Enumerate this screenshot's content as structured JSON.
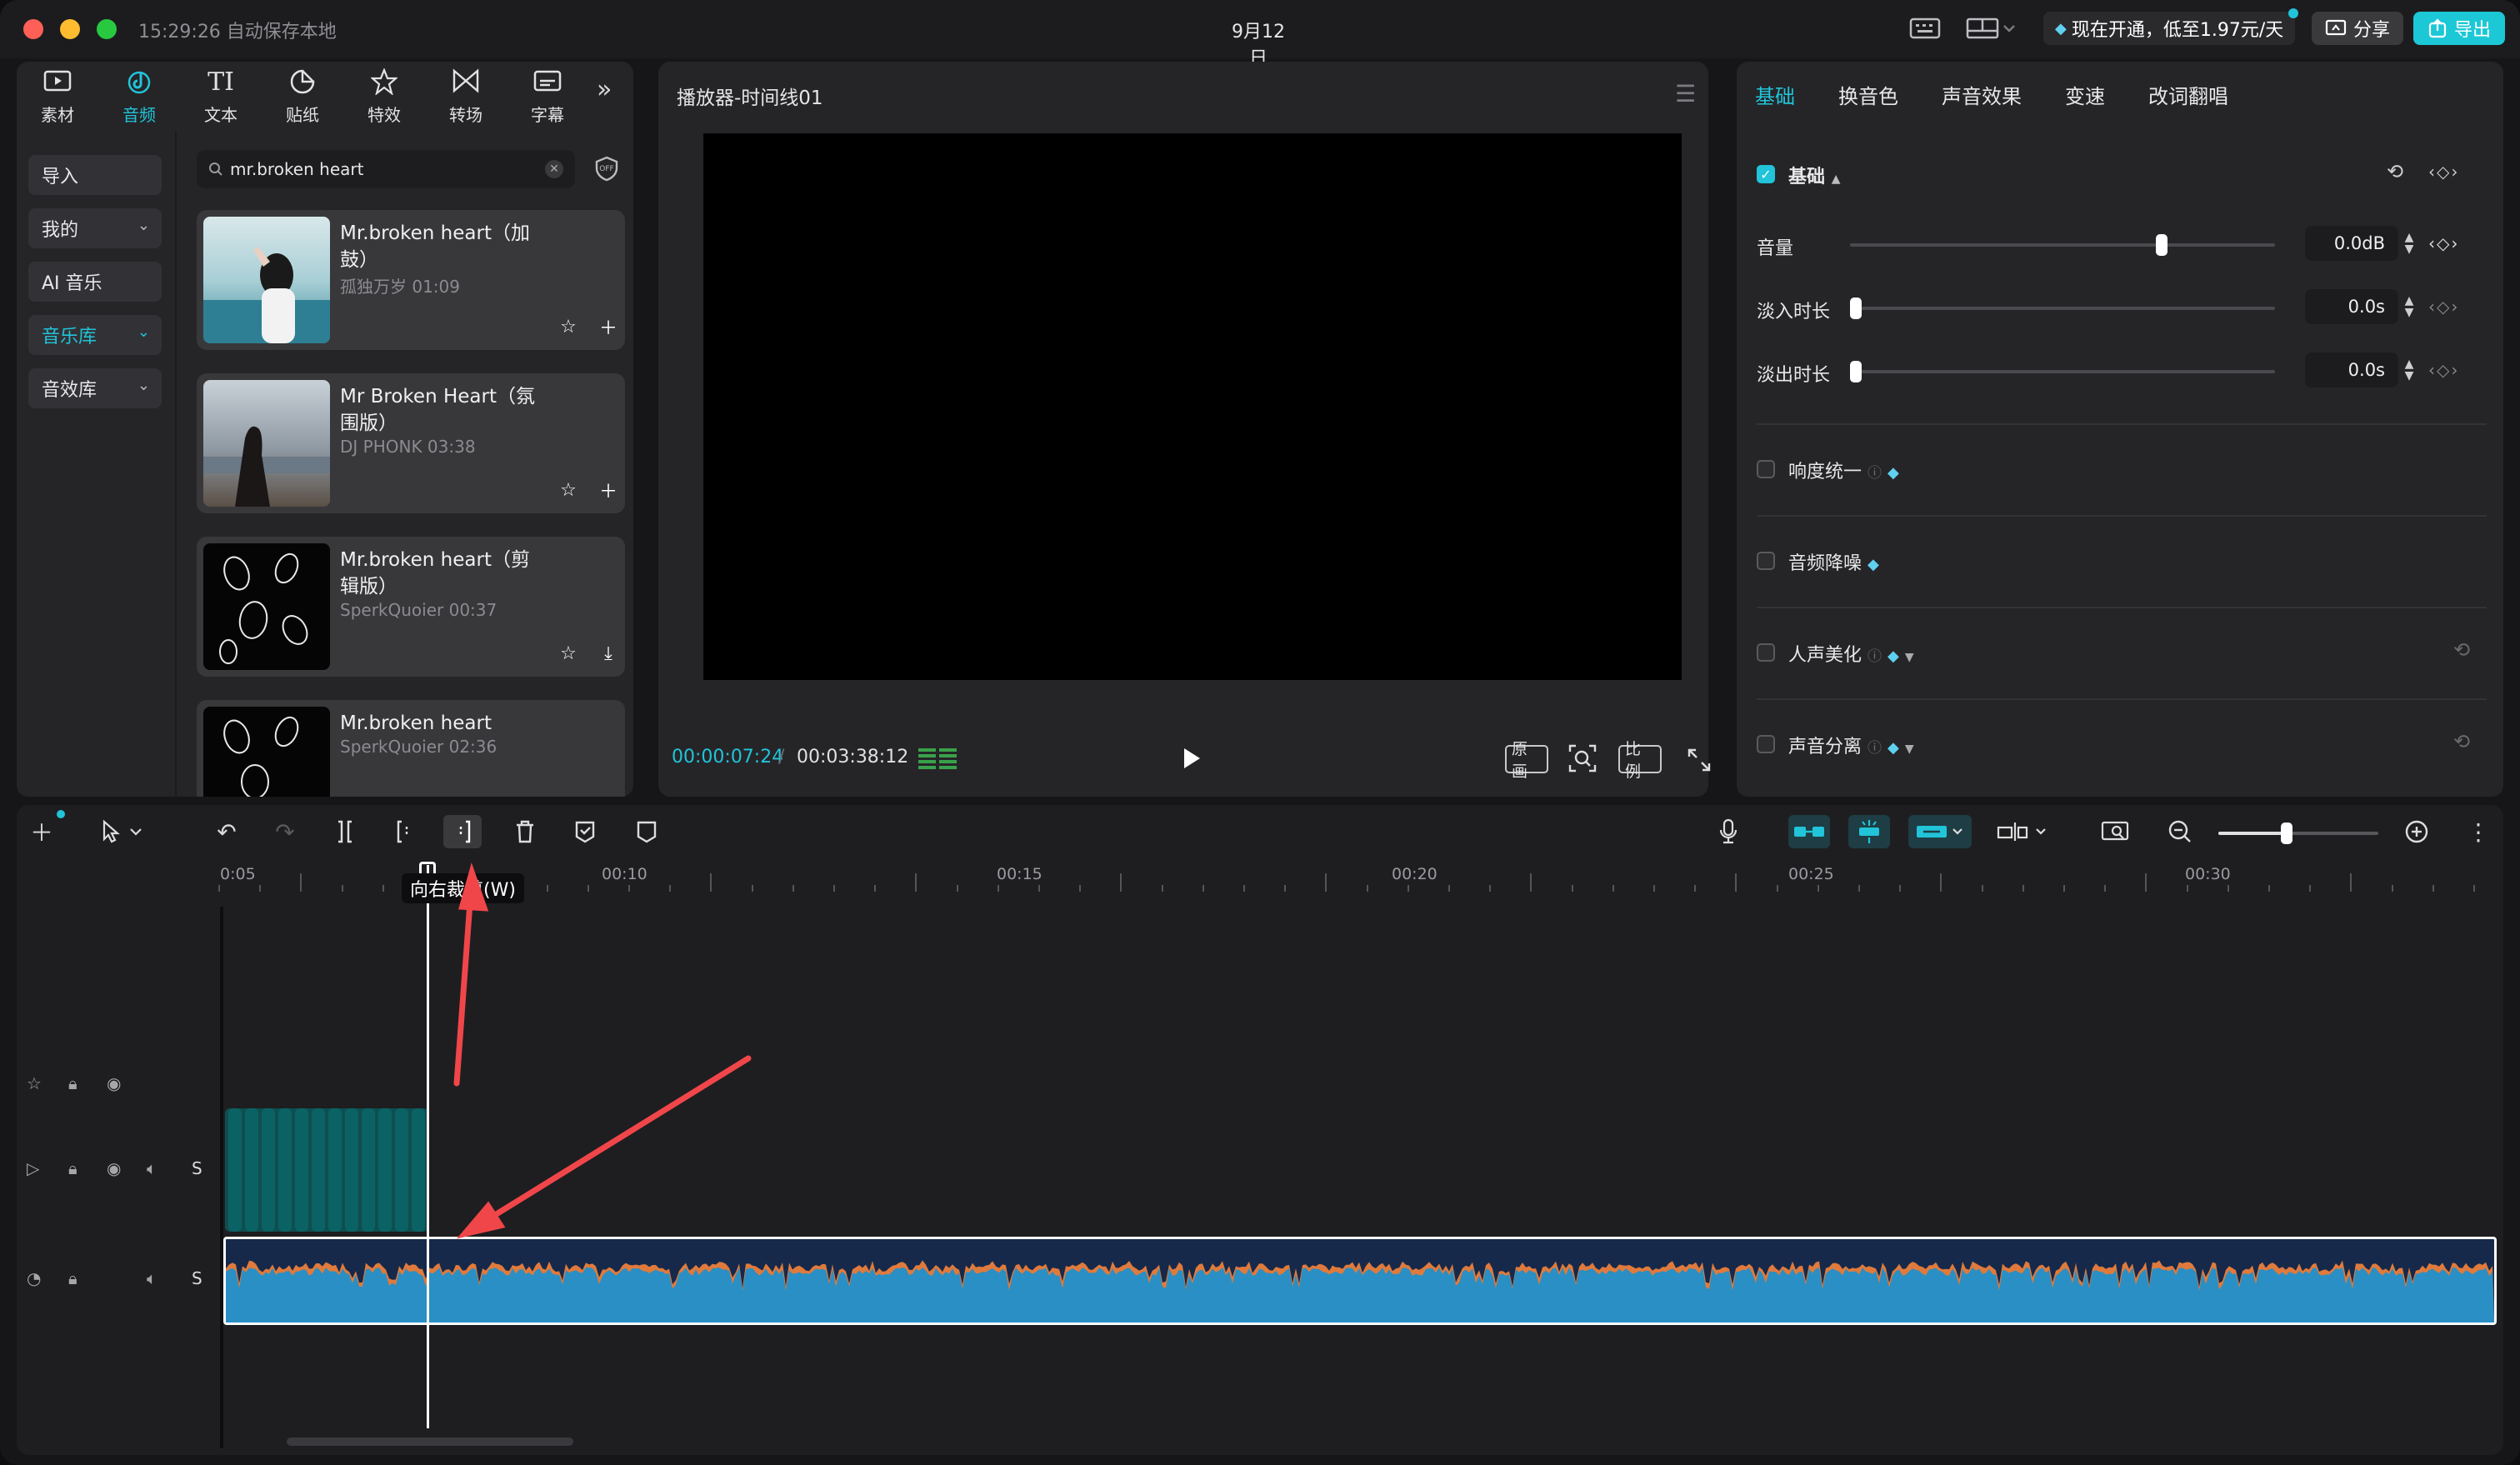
{
  "titlebar": {
    "autosave": "15:29:26 自动保存本地",
    "date": "9月12日",
    "promo": "现在开通，低至1.97元/天",
    "share": "分享",
    "export": "导出"
  },
  "media_tabs": [
    {
      "label": "素材",
      "icon": "media-icon"
    },
    {
      "label": "音频",
      "icon": "audio-icon"
    },
    {
      "label": "文本",
      "icon": "text-icon"
    },
    {
      "label": "贴纸",
      "icon": "sticker-icon"
    },
    {
      "label": "特效",
      "icon": "effects-icon"
    },
    {
      "label": "转场",
      "icon": "transition-icon"
    },
    {
      "label": "字幕",
      "icon": "subtitle-icon"
    }
  ],
  "media_sidebar": [
    {
      "label": "导入",
      "chevron": false,
      "active": false
    },
    {
      "label": "我的",
      "chevron": true,
      "active": false
    },
    {
      "label": "AI 音乐",
      "chevron": false,
      "active": false
    },
    {
      "label": "音乐库",
      "chevron": true,
      "active": true
    },
    {
      "label": "音效库",
      "chevron": true,
      "active": false
    }
  ],
  "search": {
    "value": "mr.broken heart"
  },
  "songs": [
    {
      "title": "Mr.broken heart（加鼓）",
      "meta": "孤独万岁 01:09",
      "action": "add"
    },
    {
      "title": "Mr Broken Heart（氛围版）",
      "meta": "DJ PHONK 03:38",
      "action": "add"
    },
    {
      "title": "Mr.broken heart（剪辑版）",
      "meta": "SperkQuoier 00:37",
      "action": "download"
    },
    {
      "title": "Mr.broken heart",
      "meta": "SperkQuoier 02:36",
      "action": "none"
    }
  ],
  "player": {
    "title": "播放器-时间线01",
    "current_time": "00:00:07:24",
    "separator": "/",
    "total_time": "00:03:38:12",
    "btn_original": "原画",
    "btn_ratio": "比例"
  },
  "props": {
    "tabs": [
      "基础",
      "换音色",
      "声音效果",
      "变速",
      "改词翻唱"
    ],
    "section": "基础",
    "volume_label": "音量",
    "volume_value": "0.0dB",
    "volume_level": 0.74,
    "fadein_label": "淡入时长",
    "fadein_value": "0.0s",
    "fadein_level": 0.0,
    "fadeout_label": "淡出时长",
    "fadeout_value": "0.0s",
    "fadeout_level": 0.0,
    "options": [
      "响度统一",
      "音频降噪",
      "人声美化",
      "声音分离"
    ]
  },
  "timeline": {
    "ruler_labels": [
      "0:05",
      "00:10",
      "00:15",
      "00:20",
      "00:25",
      "00:30"
    ],
    "tooltip": "向右裁剪(W)",
    "track_solo": "S",
    "zoom_level": 0.42
  },
  "colors": {
    "accent": "#21c4d9",
    "waveform_light": "#2a8fc4",
    "waveform_peak": "#e07a3c",
    "annotation_arrow": "#f0464a"
  }
}
